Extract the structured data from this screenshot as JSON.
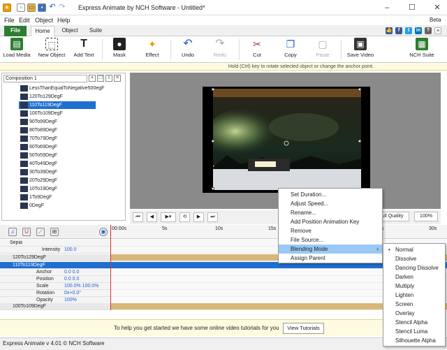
{
  "window": {
    "title": "Express Animate by NCH Software - Untitled*",
    "beta": "Beta"
  },
  "menubar": [
    "File",
    "Edit",
    "Object",
    "Help"
  ],
  "tabs": [
    "File",
    "Home",
    "Object",
    "Suite"
  ],
  "ribbon": [
    {
      "label": "Load Media",
      "icon": "load-media-icon",
      "color": "#2e7d32"
    },
    {
      "label": "New Object",
      "icon": "new-object-icon",
      "color": "#555555"
    },
    {
      "label": "Add Text",
      "icon": "add-text-icon",
      "color": "#333333"
    },
    {
      "label": "Mask",
      "icon": "mask-icon",
      "color": "#222222"
    },
    {
      "label": "Effect",
      "icon": "effect-icon",
      "color": "#e0a000"
    },
    {
      "label": "Undo",
      "icon": "undo-icon",
      "color": "#1e5bd0"
    },
    {
      "label": "Redo",
      "icon": "redo-icon",
      "color": "#aaaaaa"
    },
    {
      "label": "Cut",
      "icon": "cut-icon",
      "color": "#c03030"
    },
    {
      "label": "Copy",
      "icon": "copy-icon",
      "color": "#1e5bd0"
    },
    {
      "label": "Paste",
      "icon": "paste-icon",
      "color": "#aaaaaa"
    },
    {
      "label": "Save Video",
      "icon": "save-video-icon",
      "color": "#333333"
    },
    {
      "label": "NCH Suite",
      "icon": "nch-suite-icon",
      "color": "#2e7d32"
    }
  ],
  "hint": "Hold (Ctrl) key to rotate selected object or change the anchor point.",
  "composition": "Composition 1",
  "layers": [
    "LessThanEqualToNegative500egF",
    "120To129DegF",
    "110To119DegF",
    "100To109DegF",
    "90To99DegF",
    "80To89DegF",
    "70To79DegF",
    "60To69DegF",
    "50To59DegF",
    "40To49DegF",
    "30To39DegF",
    "20To29DegF",
    "10To19DegF",
    "1To9DegF",
    "0DegF"
  ],
  "selected_layer_index": 2,
  "transport": {
    "quality": "Full Quality",
    "zoom": "100%"
  },
  "ruler": [
    "00:00s",
    "5s",
    "10s",
    "15s",
    "20s",
    "25s",
    "30s"
  ],
  "timeline": {
    "sepia": "Sepia",
    "intensity_label": "Intensity",
    "intensity_value": "100.0",
    "row1": "120To129DegF",
    "row2": "110To119DegF",
    "props": [
      {
        "name": "Anchor",
        "value": "0.0  0.0"
      },
      {
        "name": "Position",
        "value": "0.0  0.0"
      },
      {
        "name": "Scale",
        "value": "100.0%  100.0%"
      },
      {
        "name": "Rotation",
        "value": "0x+0.0°"
      },
      {
        "name": "Opacity",
        "value": "100%"
      }
    ],
    "row3": "100To109DegF"
  },
  "context_menu": [
    "Set Duration...",
    "Adjust Speed...",
    "Rename...",
    "Add Position Animation Key",
    "Remove",
    "File Source...",
    "Blending Mode",
    "Assign Parent"
  ],
  "context_highlight": "Blending Mode",
  "blend_menu": [
    "Normal",
    "Dissolve",
    "Dancing Dissolve",
    "Darken",
    "Multiply",
    "Lighten",
    "Screen",
    "Overlay",
    "Stencil Alpha",
    "Stencil Luma",
    "Silhouette Alpha"
  ],
  "blend_selected": "Normal",
  "banner": {
    "text": "To help you get started we have some online video tutorials for you",
    "button": "View Tutorials"
  },
  "status": "Express Animate v 4.01 © NCH Software"
}
